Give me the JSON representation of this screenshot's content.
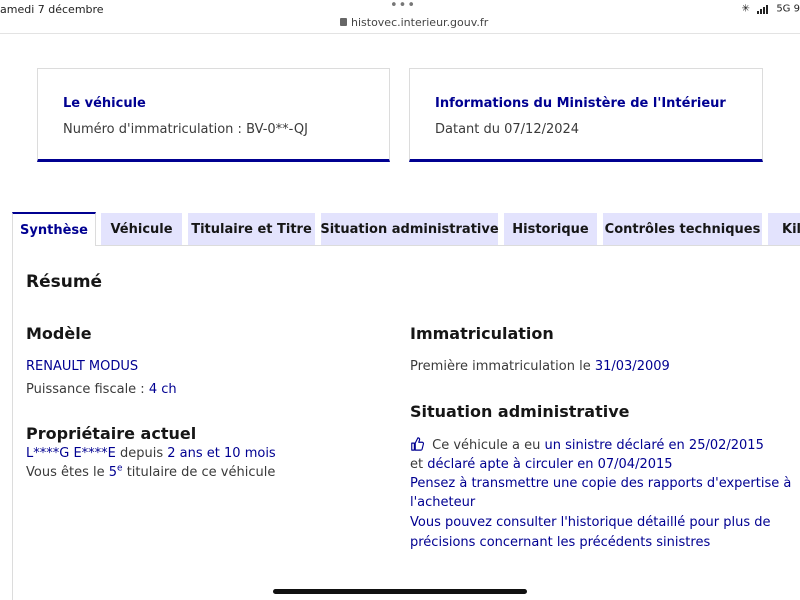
{
  "statusbar": {
    "date": "amedi 7 décembre",
    "url": "histovec.interieur.gouv.fr",
    "network": "5G",
    "battery": "9"
  },
  "cards": {
    "vehicle": {
      "title": "Le véhicule",
      "text": "Numéro d'immatriculation : BV-0**-QJ"
    },
    "ministry": {
      "title": "Informations du Ministère de l'Intérieur",
      "text": "Datant du 07/12/2024"
    }
  },
  "tabs": [
    {
      "label": "Synthèse"
    },
    {
      "label": "Véhicule"
    },
    {
      "label": "Titulaire et Titre"
    },
    {
      "label": "Situation administrative"
    },
    {
      "label": "Historique"
    },
    {
      "label": "Contrôles techniques"
    },
    {
      "label": "Kilo"
    }
  ],
  "summary": {
    "title": "Résumé",
    "model": {
      "heading": "Modèle",
      "name": "RENAULT MODUS",
      "power_label": "Puissance fiscale : ",
      "power_value": "4 ch"
    },
    "owner": {
      "heading": "Propriétaire actuel",
      "name": "L****G E****E",
      "since_label": " depuis ",
      "since_value": "2 ans et 10 mois",
      "rank_prefix": "Vous êtes le ",
      "rank_value": "5",
      "rank_sup": "e",
      "rank_suffix": " titulaire de ce véhicule"
    },
    "registration": {
      "heading": "Immatriculation",
      "label": "Première immatriculation le ",
      "date": "31/03/2009"
    },
    "admin": {
      "heading": "Situation administrative",
      "line1_prefix": " Ce véhicule a eu ",
      "line1_link": "un sinistre déclaré en 25/02/2015",
      "line2_prefix": "et ",
      "line2_link": "déclaré apte à circuler en 07/04/2015",
      "advice_1": "Pensez à transmettre une copie des rapports d'expertise à",
      "advice_2": "l'acheteur",
      "history_1": "Vous pouvez consulter l'historique détaillé pour plus de",
      "history_2": "précisions concernant les précédents sinistres"
    }
  }
}
